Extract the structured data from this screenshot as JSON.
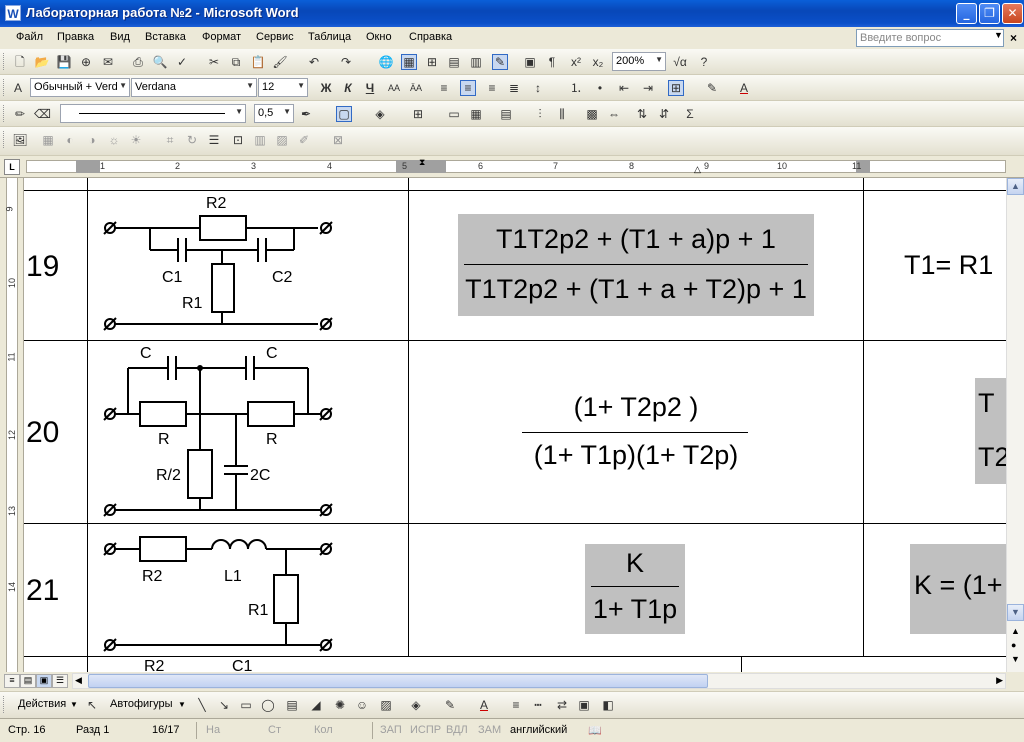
{
  "window": {
    "title": "Лабораторная работа №2 - Microsoft Word",
    "app_icon": "W",
    "minimize_icon": "minimize-icon",
    "maximize_icon": "restore-icon",
    "close_icon": "close-icon"
  },
  "menu": {
    "items": [
      "Файл",
      "Правка",
      "Вид",
      "Вставка",
      "Формат",
      "Сервис",
      "Таблица",
      "Окно",
      "Справка"
    ],
    "ask_placeholder": "Введите вопрос"
  },
  "toolbar_standard": {
    "zoom": "200%"
  },
  "toolbar_formatting": {
    "style": "Обычный + Verd",
    "font": "Verdana",
    "size": "12"
  },
  "toolbar_tables": {
    "line_weight": "0,5"
  },
  "ruler": {
    "marks": [
      "1",
      "2",
      "3",
      "4",
      "5",
      "6",
      "7",
      "8",
      "9",
      "10",
      "11"
    ],
    "vmarks": [
      "9",
      "10",
      "11",
      "12",
      "13",
      "14"
    ]
  },
  "table": {
    "rows": [
      {
        "num": "19",
        "components": [
          "R2",
          "C1",
          "C2",
          "R1"
        ],
        "formula": {
          "numerator": "T1T2p2 + (T1 + a)p + 1",
          "denominator": "T1T2p2 + (T1 + a + T2)p + 1"
        },
        "param_visible": "T1= R1"
      },
      {
        "num": "20",
        "components": [
          "C",
          "C",
          "R",
          "R",
          "R/2",
          "2C"
        ],
        "formula": {
          "numerator": "(1+ T2p2 )",
          "denominator": "(1+ T1p)(1+ T2p)"
        },
        "param_visible": [
          "T",
          "T2"
        ]
      },
      {
        "num": "21",
        "components": [
          "R2",
          "L1",
          "R1"
        ],
        "formula": {
          "numerator": "K",
          "denominator": "1+ T1p"
        },
        "param_visible": "K = (1+"
      }
    ],
    "partial_row_labels": [
      "R2",
      "C1"
    ]
  },
  "drawing_toolbar": {
    "actions": "Действия",
    "autoshapes": "Автофигуры"
  },
  "status": {
    "page": "Стр. 16",
    "section": "Разд 1",
    "pages": "16/17",
    "at": "На",
    "ln": "Ст",
    "col": "Кол",
    "rec": "ЗАП",
    "trk": "ИСПР",
    "ext": "ВДЛ",
    "ovr": "ЗАМ",
    "language": "английский"
  }
}
